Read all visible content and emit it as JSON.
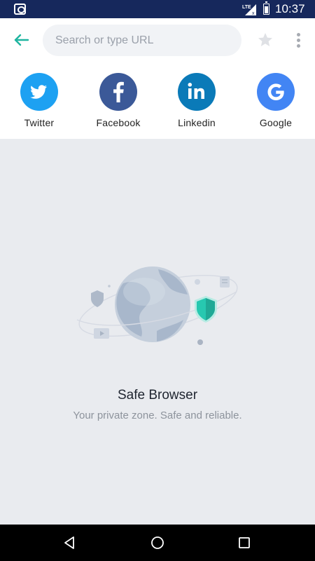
{
  "status_bar": {
    "network": "LTE",
    "time": "10:37",
    "icons": [
      "app-notification-icon",
      "lte-signal-icon",
      "battery-icon"
    ]
  },
  "toolbar": {
    "back_icon": "back-arrow-icon",
    "search_placeholder": "Search or type URL",
    "search_value": "",
    "bookmark_icon": "star-icon",
    "menu_icon": "more-vert-icon"
  },
  "shortcuts": [
    {
      "label": "Twitter",
      "icon": "twitter-icon",
      "color": "#1da1f2"
    },
    {
      "label": "Facebook",
      "icon": "facebook-icon",
      "color": "#3b5998"
    },
    {
      "label": "Linkedin",
      "icon": "linkedin-icon",
      "color": "#0a7ab8"
    },
    {
      "label": "Google",
      "icon": "google-icon",
      "color": "#4285f4"
    }
  ],
  "main": {
    "title": "Safe Browser",
    "subtitle": "Your private zone. Safe and reliable.",
    "accent_color": "#27c8b0"
  },
  "nav_bar": {
    "buttons": [
      "back-triangle-icon",
      "home-circle-icon",
      "recents-square-icon"
    ]
  }
}
